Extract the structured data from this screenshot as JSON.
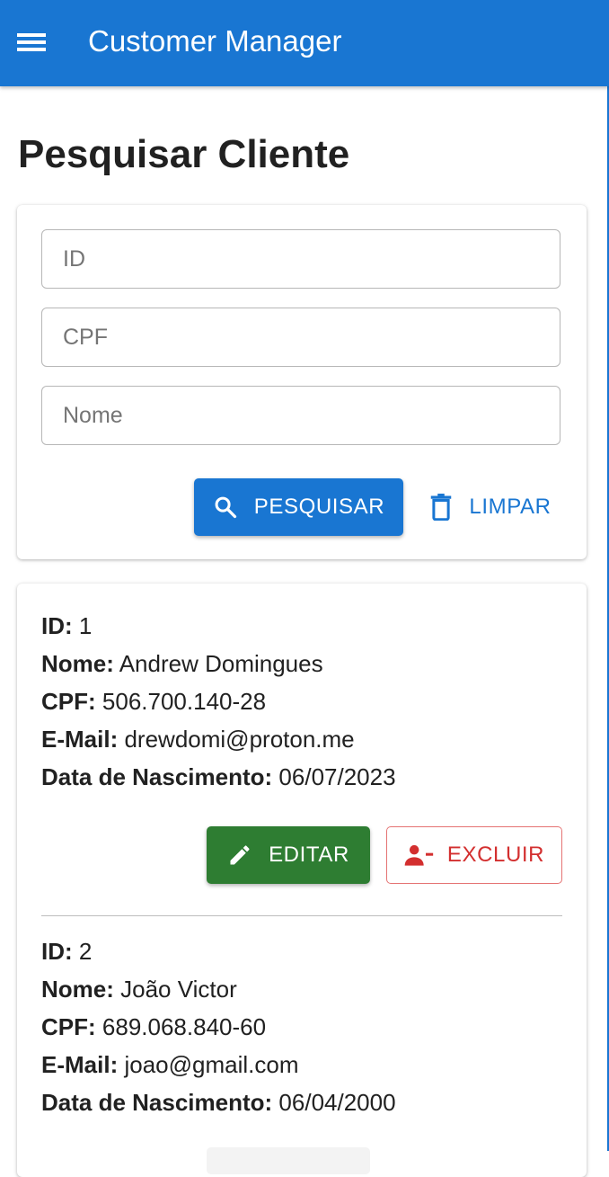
{
  "app": {
    "title": "Customer Manager",
    "icon": "menu-icon"
  },
  "page": {
    "title": "Pesquisar Cliente"
  },
  "search": {
    "fields": [
      {
        "placeholder": "ID",
        "value": ""
      },
      {
        "placeholder": "CPF",
        "value": ""
      },
      {
        "placeholder": "Nome",
        "value": ""
      }
    ],
    "search_label": "PESQUISAR",
    "search_icon": "search-icon",
    "clear_label": "LIMPAR",
    "clear_icon": "trash-icon"
  },
  "labels": {
    "id": "ID:",
    "nome": "Nome:",
    "cpf": "CPF:",
    "email": "E-Mail:",
    "nascimento": "Data de Nascimento:"
  },
  "actions": {
    "edit_label": "EDITAR",
    "edit_icon": "pencil-icon",
    "delete_label": "EXCLUIR",
    "delete_icon": "person-remove-icon"
  },
  "clients": [
    {
      "id": "1",
      "nome": "Andrew Domingues",
      "cpf": "506.700.140-28",
      "email": "drewdomi@proton.me",
      "nascimento": "06/07/2023"
    },
    {
      "id": "2",
      "nome": "João Victor",
      "cpf": "689.068.840-60",
      "email": "joao@gmail.com",
      "nascimento": "06/04/2000"
    }
  ],
  "colors": {
    "primary": "#1976d2",
    "edit": "#2e7d32",
    "delete": "#d32f2f"
  }
}
